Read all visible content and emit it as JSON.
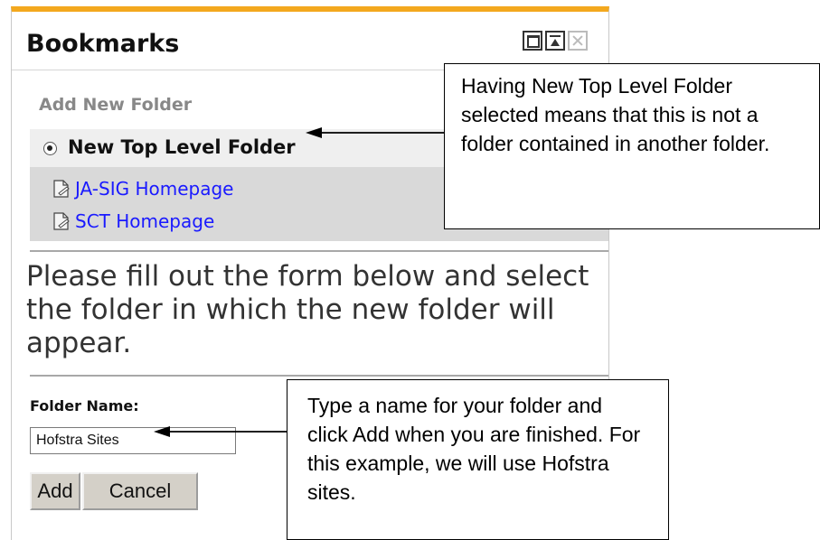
{
  "portlet": {
    "title": "Bookmarks",
    "accent_color": "#f3a81e",
    "controls": [
      "maximize-icon",
      "move-to-top-icon",
      "close-icon"
    ]
  },
  "form": {
    "heading": "Add New Folder",
    "top_level_label": "New Top Level Folder",
    "top_level_selected": true,
    "bookmarks": [
      {
        "label": "JA-SIG Homepage",
        "icon": "bookmark-doc-icon"
      },
      {
        "label": "SCT Homepage",
        "icon": "bookmark-doc-icon"
      }
    ],
    "instructions": "Please fill out the form below and select the folder in which the new folder will appear.",
    "folder_name_label": "Folder Name:",
    "folder_name_value": "Hofstra Sites",
    "add_label": "Add",
    "cancel_label": "Cancel"
  },
  "callouts": {
    "top_level_note": "Having New Top Level Folder selected means that this is not a folder contained in another folder.",
    "name_note": "Type a name for your folder and click Add when you are finished. For this example, we will use Hofstra sites."
  }
}
